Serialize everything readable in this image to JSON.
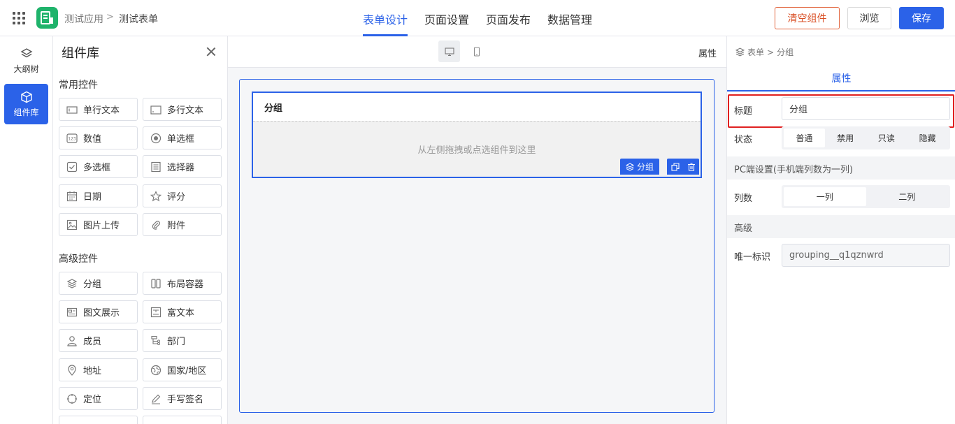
{
  "header": {
    "app_name": "测试应用",
    "separator": ">",
    "form_name": "测试表单",
    "tabs": [
      {
        "label": "表单设计",
        "active": true
      },
      {
        "label": "页面设置",
        "active": false
      },
      {
        "label": "页面发布",
        "active": false
      },
      {
        "label": "数据管理",
        "active": false
      }
    ],
    "clear_label": "清空组件",
    "preview_label": "浏览",
    "save_label": "保存",
    "accent_color": "#2b62e8",
    "danger_color": "#d94e23"
  },
  "rail": {
    "outline_label": "大纲树",
    "library_label": "组件库"
  },
  "library": {
    "title": "组件库",
    "common_title": "常用控件",
    "common": [
      {
        "label": "单行文本",
        "icon": "single-line-text-icon"
      },
      {
        "label": "多行文本",
        "icon": "multi-line-text-icon"
      },
      {
        "label": "数值",
        "icon": "number-icon"
      },
      {
        "label": "单选框",
        "icon": "radio-icon"
      },
      {
        "label": "多选框",
        "icon": "checkbox-icon"
      },
      {
        "label": "选择器",
        "icon": "select-icon"
      },
      {
        "label": "日期",
        "icon": "calendar-icon"
      },
      {
        "label": "评分",
        "icon": "star-icon"
      },
      {
        "label": "图片上传",
        "icon": "image-icon"
      },
      {
        "label": "附件",
        "icon": "paperclip-icon"
      }
    ],
    "advanced_title": "高级控件",
    "advanced": [
      {
        "label": "分组",
        "icon": "layers-icon"
      },
      {
        "label": "布局容器",
        "icon": "columns-icon"
      },
      {
        "label": "图文展示",
        "icon": "card-icon"
      },
      {
        "label": "富文本",
        "icon": "rich-text-icon"
      },
      {
        "label": "成员",
        "icon": "user-icon"
      },
      {
        "label": "部门",
        "icon": "org-icon"
      },
      {
        "label": "地址",
        "icon": "map-pin-icon"
      },
      {
        "label": "国家/地区",
        "icon": "globe-icon"
      },
      {
        "label": "定位",
        "icon": "crosshair-icon"
      },
      {
        "label": "手写签名",
        "icon": "pen-icon"
      }
    ]
  },
  "canvas": {
    "properties_label": "属性",
    "group_title": "分组",
    "drop_hint": "从左侧拖拽或点选组件到这里",
    "group_tag": "分组"
  },
  "properties": {
    "crumb_root": "表单",
    "crumb_sep": ">",
    "crumb_current": "分组",
    "tab_label": "属性",
    "title_label": "标题",
    "title_value": "分组",
    "status_label": "状态",
    "status_options": [
      {
        "label": "普通",
        "active": true
      },
      {
        "label": "禁用",
        "active": false
      },
      {
        "label": "只读",
        "active": false
      },
      {
        "label": "隐藏",
        "active": false
      }
    ],
    "pc_section": "PC端设置(手机端列数为一列)",
    "columns_label": "列数",
    "column_options": [
      {
        "label": "一列",
        "active": true
      },
      {
        "label": "二列",
        "active": false
      }
    ],
    "advanced_section": "高级",
    "uid_label": "唯一标识",
    "uid_value": "grouping__q1qznwrd"
  }
}
